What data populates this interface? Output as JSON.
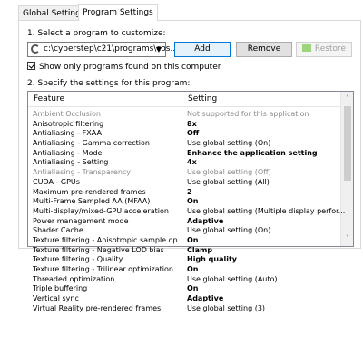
{
  "tabs": [
    {
      "label": "Global Settings"
    },
    {
      "label": "Program Settings"
    }
  ],
  "step1": {
    "label": "1. Select a program to customize:"
  },
  "program": {
    "value": "c:\\cyberstep\\c21\\programs\\cos..."
  },
  "buttons": {
    "add": "Add",
    "remove": "Remove",
    "restore": "Restore"
  },
  "show_only": {
    "label": "Show only programs found on this computer",
    "checked": true
  },
  "step2": {
    "label": "2. Specify the settings for this program:"
  },
  "columns": {
    "feature": "Feature",
    "setting": "Setting"
  },
  "rows": [
    {
      "feature": "Ambient Occlusion",
      "setting": "Not supported for this application",
      "grey": true,
      "bold": false
    },
    {
      "feature": "Anisotropic filtering",
      "setting": "8x",
      "grey": false,
      "bold": true
    },
    {
      "feature": "Antialiasing - FXAA",
      "setting": "Off",
      "grey": false,
      "bold": true
    },
    {
      "feature": "Antialiasing - Gamma correction",
      "setting": "Use global setting (On)",
      "grey": false,
      "bold": false
    },
    {
      "feature": "Antialiasing - Mode",
      "setting": "Enhance the application setting",
      "grey": false,
      "bold": true
    },
    {
      "feature": "Antialiasing - Setting",
      "setting": "4x",
      "grey": false,
      "bold": true
    },
    {
      "feature": "Antialiasing - Transparency",
      "setting": "Use global setting (Off)",
      "grey": true,
      "bold": false
    },
    {
      "feature": "CUDA - GPUs",
      "setting": "Use global setting (All)",
      "grey": false,
      "bold": false
    },
    {
      "feature": "Maximum pre-rendered frames",
      "setting": "2",
      "grey": false,
      "bold": true
    },
    {
      "feature": "Multi-Frame Sampled AA (MFAA)",
      "setting": "On",
      "grey": false,
      "bold": true
    },
    {
      "feature": "Multi-display/mixed-GPU acceleration",
      "setting": "Use global setting (Multiple display perfor...",
      "grey": false,
      "bold": false
    },
    {
      "feature": "Power management mode",
      "setting": "Adaptive",
      "grey": false,
      "bold": true
    },
    {
      "feature": "Shader Cache",
      "setting": "Use global setting (On)",
      "grey": false,
      "bold": false
    },
    {
      "feature": "Texture filtering - Anisotropic sample opti...",
      "setting": "On",
      "grey": false,
      "bold": true
    },
    {
      "feature": "Texture filtering - Negative LOD bias",
      "setting": "Clamp",
      "grey": false,
      "bold": true
    },
    {
      "feature": "Texture filtering - Quality",
      "setting": "High quality",
      "grey": false,
      "bold": true
    },
    {
      "feature": "Texture filtering - Trilinear optimization",
      "setting": "On",
      "grey": false,
      "bold": true
    },
    {
      "feature": "Threaded optimization",
      "setting": "Use global setting (Auto)",
      "grey": false,
      "bold": false
    },
    {
      "feature": "Triple buffering",
      "setting": "On",
      "grey": false,
      "bold": true
    },
    {
      "feature": "Vertical sync",
      "setting": "Adaptive",
      "grey": false,
      "bold": true
    },
    {
      "feature": "Virtual Reality pre-rendered frames",
      "setting": "Use global setting (3)",
      "grey": false,
      "bold": false
    }
  ]
}
